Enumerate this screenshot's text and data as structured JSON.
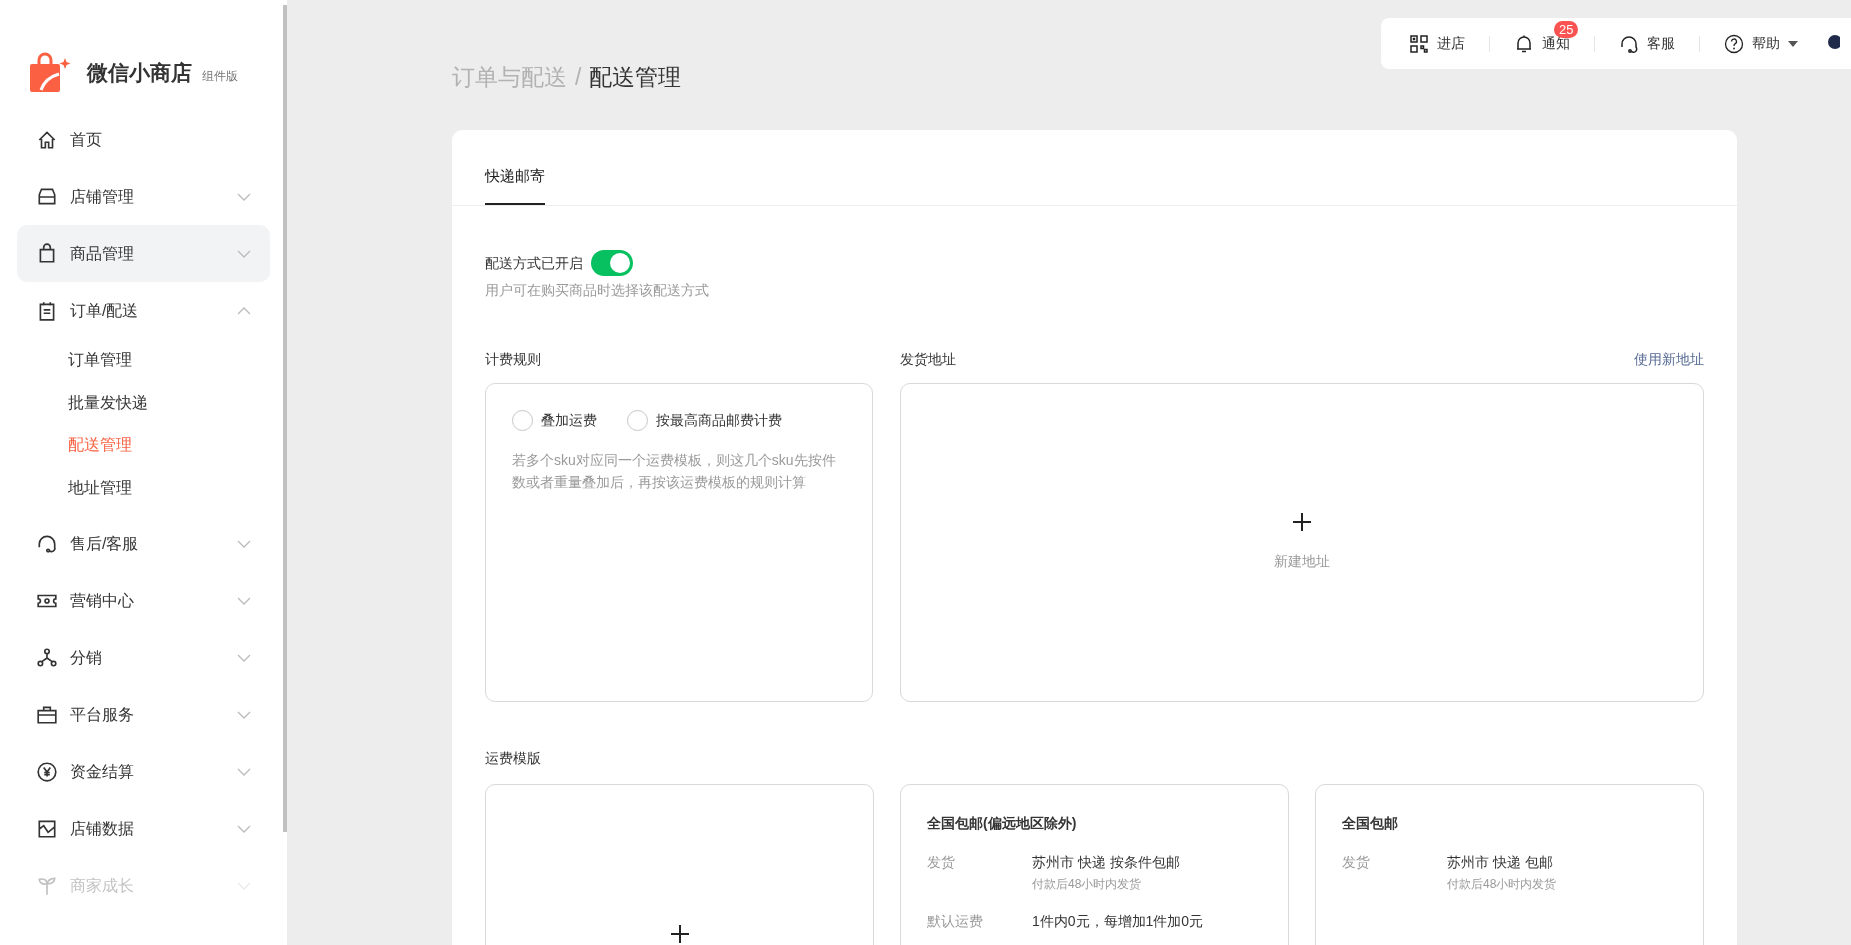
{
  "brand": {
    "name": "微信小商店",
    "edition": "组件版"
  },
  "nav": [
    {
      "label": "首页",
      "kind": "link",
      "highlighted": false,
      "dimmed": false
    },
    {
      "label": "店铺管理",
      "kind": "group",
      "expanded": false,
      "highlighted": false,
      "dimmed": false
    },
    {
      "label": "商品管理",
      "kind": "group",
      "expanded": false,
      "highlighted": true,
      "dimmed": false
    },
    {
      "label": "订单/配送",
      "kind": "group",
      "expanded": true,
      "highlighted": false,
      "dimmed": false,
      "children": [
        {
          "label": "订单管理",
          "selected": false
        },
        {
          "label": "批量发快递",
          "selected": false
        },
        {
          "label": "配送管理",
          "selected": true
        },
        {
          "label": "地址管理",
          "selected": false
        }
      ]
    },
    {
      "label": "售后/客服",
      "kind": "group",
      "expanded": false,
      "highlighted": false,
      "dimmed": false
    },
    {
      "label": "营销中心",
      "kind": "group",
      "expanded": false,
      "highlighted": false,
      "dimmed": false
    },
    {
      "label": "分销",
      "kind": "group",
      "expanded": false,
      "highlighted": false,
      "dimmed": false
    },
    {
      "label": "平台服务",
      "kind": "group",
      "expanded": false,
      "highlighted": false,
      "dimmed": false
    },
    {
      "label": "资金结算",
      "kind": "group",
      "expanded": false,
      "highlighted": false,
      "dimmed": false
    },
    {
      "label": "店铺数据",
      "kind": "group",
      "expanded": false,
      "highlighted": false,
      "dimmed": false
    },
    {
      "label": "商家成长",
      "kind": "group",
      "expanded": false,
      "highlighted": false,
      "dimmed": true
    }
  ],
  "topbar": [
    {
      "label": "进店",
      "kind": "plain"
    },
    {
      "label": "通知",
      "kind": "plain",
      "badge": "25"
    },
    {
      "label": "客服",
      "kind": "plain"
    },
    {
      "label": "帮助",
      "kind": "menu"
    }
  ],
  "breadcrumb": {
    "parent": "订单与配送",
    "separator": "/",
    "current": "配送管理"
  },
  "tabs": [
    {
      "label": "快递邮寄",
      "selected": true
    }
  ],
  "delivery": {
    "label": "配送方式已开启",
    "on": true,
    "hint": "用户可在购买商品时选择该配送方式"
  },
  "billing": {
    "title": "计费规则",
    "options": [
      {
        "label": "叠加运费",
        "selected": false
      },
      {
        "label": "按最高商品邮费计费",
        "selected": false
      }
    ],
    "note": "若多个sku对应同一个运费模板，则这几个sku先按件数或者重量叠加后，再按该运费模板的规则计算"
  },
  "address": {
    "title": "发货地址",
    "link": "使用新地址",
    "add_label": "新建地址"
  },
  "templates": {
    "title": "运费模版",
    "items": [
      {
        "kind": "new"
      },
      {
        "kind": "template",
        "name": "全国包邮(偏远地区除外)",
        "rows": [
          {
            "label": "发货",
            "value": "苏州市 快递 按条件包邮",
            "sub": "付款后48小时内发货"
          },
          {
            "label": "默认运费",
            "value": "1件内0元，每增加1件加0元"
          }
        ]
      },
      {
        "kind": "template",
        "name": "全国包邮",
        "rows": [
          {
            "label": "发货",
            "value": "苏州市 快递 包邮",
            "sub": "付款后48小时内发货"
          }
        ]
      }
    ]
  }
}
